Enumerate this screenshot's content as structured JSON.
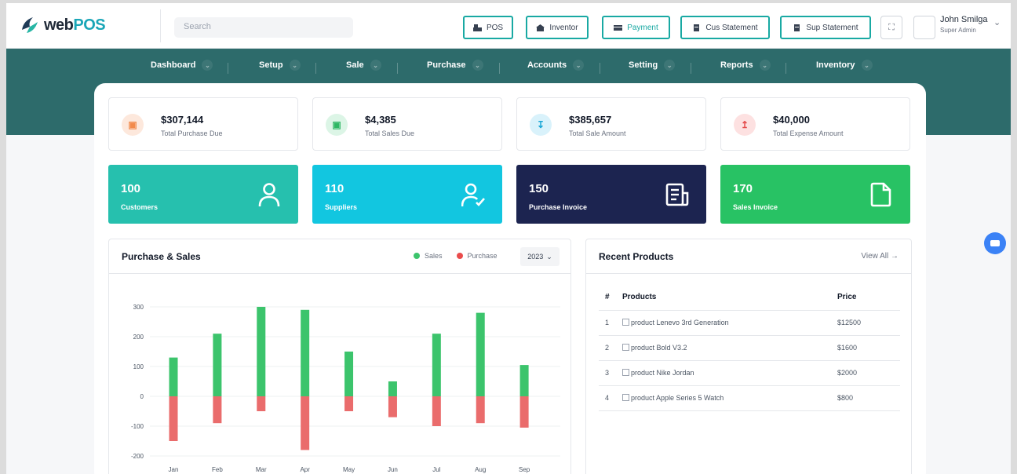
{
  "app": {
    "brand_prefix": "web",
    "brand_suffix": "POS"
  },
  "search": {
    "placeholder": "Search"
  },
  "quick_buttons": [
    {
      "label": "POS"
    },
    {
      "label": "Inventor"
    },
    {
      "label": "Payment"
    },
    {
      "label": "Cus Statement"
    },
    {
      "label": "Sup Statement"
    }
  ],
  "user": {
    "name": "John Smilga",
    "role": "Super Admin"
  },
  "nav": [
    {
      "label": "Dashboard"
    },
    {
      "label": "Setup"
    },
    {
      "label": "Sale"
    },
    {
      "label": "Purchase"
    },
    {
      "label": "Accounts"
    },
    {
      "label": "Setting"
    },
    {
      "label": "Reports"
    },
    {
      "label": "Inventory"
    }
  ],
  "stats": [
    {
      "value": "$307,144",
      "label": "Total Purchase Due"
    },
    {
      "value": "$4,385",
      "label": "Total Sales Due"
    },
    {
      "value": "$385,657",
      "label": "Total Sale Amount"
    },
    {
      "value": "$40,000",
      "label": "Total Expense Amount"
    }
  ],
  "counts": [
    {
      "value": "100",
      "label": "Customers"
    },
    {
      "value": "110",
      "label": "Suppliers"
    },
    {
      "value": "150",
      "label": "Purchase Invoice"
    },
    {
      "value": "170",
      "label": "Sales Invoice"
    }
  ],
  "chart_card": {
    "title": "Purchase & Sales",
    "legend_sales": "Sales",
    "legend_purchase": "Purchase",
    "year": "2023"
  },
  "recent_products": {
    "title": "Recent Products",
    "view_all": "View All",
    "headers": {
      "num": "#",
      "product": "Products",
      "price": "Price"
    },
    "rows": [
      {
        "num": "1",
        "product": "product Lenevo 3rd Generation",
        "price": "$12500"
      },
      {
        "num": "2",
        "product": "product Bold V3.2",
        "price": "$1600"
      },
      {
        "num": "3",
        "product": "product Nike Jordan",
        "price": "$2000"
      },
      {
        "num": "4",
        "product": "product Apple Series 5 Watch",
        "price": "$800"
      }
    ]
  },
  "colors": {
    "teal_band": "#2d6b6b",
    "sales": "#3cc46c",
    "purchase": "#ea6c6c",
    "customers": "#26c0ae",
    "suppliers": "#12c6e0",
    "purchase_invoice": "#1c2450",
    "sales_invoice": "#28c264"
  },
  "chart_data": {
    "type": "bar",
    "categories": [
      "Jan",
      "Feb",
      "Mar",
      "Apr",
      "May",
      "Jun",
      "Jul",
      "Aug",
      "Sep"
    ],
    "series": [
      {
        "name": "Sales",
        "values": [
          130,
          210,
          300,
          290,
          150,
          50,
          210,
          280,
          105
        ]
      },
      {
        "name": "Purchase",
        "values": [
          -150,
          -90,
          -50,
          -180,
          -50,
          -70,
          -100,
          -90,
          -105
        ]
      }
    ],
    "ylim": [
      -200,
      300
    ],
    "yticks": [
      "300",
      "200",
      "100",
      "0",
      "-100",
      "-200"
    ],
    "stacked": true,
    "grid": true
  }
}
